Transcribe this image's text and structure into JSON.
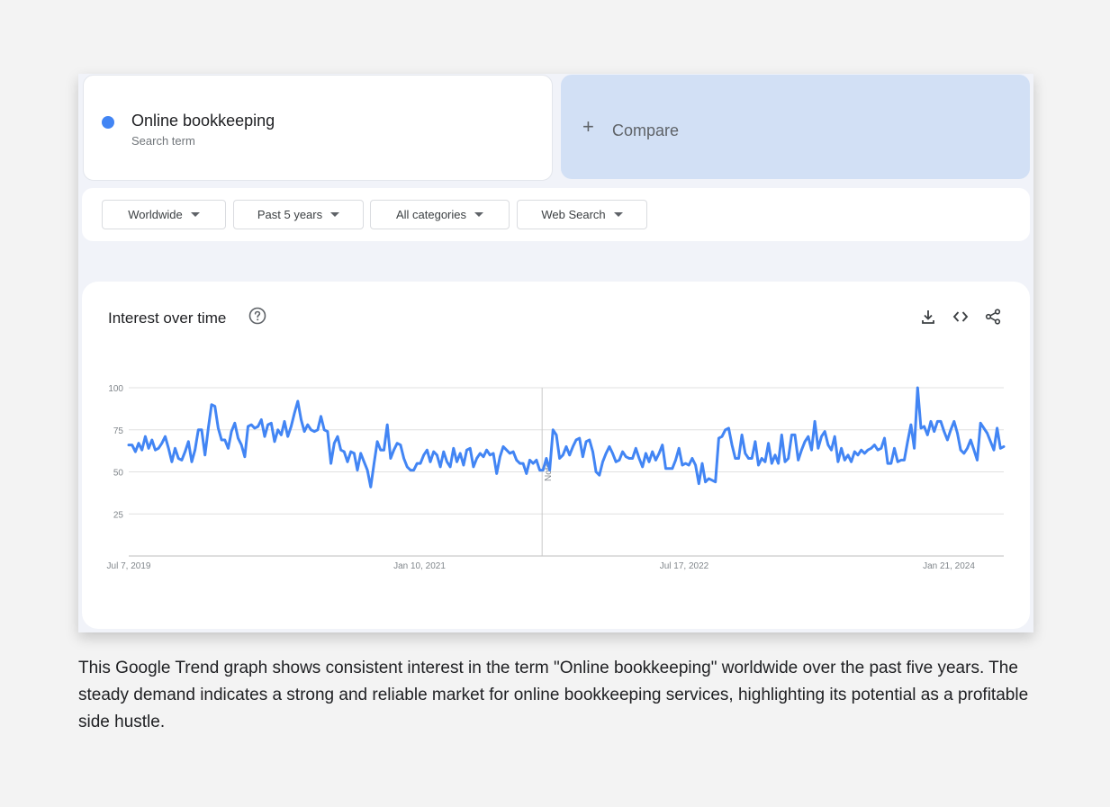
{
  "search_term": {
    "title": "Online bookkeeping",
    "subtitle": "Search term",
    "dot_color": "#4285f4"
  },
  "compare": {
    "plus": "+",
    "label": "Compare"
  },
  "filters": [
    {
      "label": "Worldwide"
    },
    {
      "label": "Past 5 years"
    },
    {
      "label": "All categories"
    },
    {
      "label": "Web Search"
    }
  ],
  "chart_card": {
    "title": "Interest over time",
    "help_icon": "help-circle-icon",
    "tools": [
      "download-icon",
      "embed-code-icon",
      "share-icon"
    ]
  },
  "chart_data": {
    "type": "line",
    "x_tick_labels": [
      "Jul 7, 2019",
      "Jan 10, 2021",
      "Jul 17, 2022",
      "Jan 21, 2024"
    ],
    "y_ticks": [
      100,
      75,
      50,
      25
    ],
    "ylim": [
      0,
      100
    ],
    "note_label": "Note",
    "grid": true,
    "series": [
      {
        "color": "#4285f4",
        "values": [
          66,
          66,
          62,
          67,
          63,
          71,
          64,
          69,
          63,
          64,
          67,
          71,
          64,
          56,
          64,
          58,
          57,
          62,
          68,
          56,
          63,
          75,
          75,
          60,
          76,
          90,
          89,
          76,
          69,
          69,
          64,
          74,
          79,
          70,
          66,
          59,
          77,
          78,
          76,
          77,
          81,
          71,
          78,
          79,
          68,
          75,
          72,
          80,
          71,
          77,
          85,
          92,
          81,
          74,
          78,
          75,
          74,
          75,
          83,
          75,
          74,
          55,
          67,
          71,
          63,
          62,
          56,
          62,
          61,
          51,
          61,
          56,
          51,
          41,
          55,
          68,
          63,
          63,
          78,
          58,
          63,
          67,
          66,
          58,
          53,
          51,
          51,
          55,
          55,
          60,
          63,
          56,
          62,
          60,
          53,
          62,
          56,
          53,
          64,
          56,
          61,
          54,
          63,
          64,
          53,
          58,
          61,
          59,
          63,
          60,
          61,
          49,
          59,
          65,
          63,
          61,
          62,
          57,
          55,
          55,
          49,
          57,
          55,
          57,
          51,
          51,
          58,
          51,
          75,
          72,
          58,
          60,
          65,
          60,
          65,
          69,
          70,
          59,
          68,
          69,
          62,
          50,
          48,
          56,
          61,
          65,
          61,
          56,
          57,
          62,
          59,
          58,
          58,
          64,
          58,
          53,
          61,
          56,
          62,
          57,
          61,
          66,
          52,
          52,
          52,
          57,
          64,
          54,
          55,
          54,
          58,
          54,
          43,
          55,
          44,
          46,
          45,
          44,
          70,
          71,
          75,
          76,
          66,
          58,
          58,
          72,
          61,
          58,
          58,
          68,
          54,
          58,
          56,
          67,
          55,
          60,
          55,
          72,
          56,
          58,
          72,
          72,
          57,
          63,
          68,
          71,
          63,
          80,
          64,
          71,
          74,
          66,
          63,
          71,
          56,
          64,
          57,
          60,
          56,
          62,
          60,
          63,
          61,
          63,
          64,
          66,
          63,
          64,
          70,
          55,
          55,
          64,
          56,
          57,
          57,
          68,
          78,
          64,
          100,
          76,
          77,
          72,
          80,
          74,
          80,
          80,
          74,
          69,
          75,
          80,
          73,
          63,
          61,
          64,
          69,
          63,
          57,
          79,
          76,
          73,
          68,
          63,
          76,
          64,
          65
        ]
      }
    ]
  },
  "caption": "This Google Trend graph shows consistent interest in the term \"Online bookkeeping\" worldwide over the past five years. The steady demand indicates a strong and reliable market for online bookkeeping services, highlighting its potential as a profitable side hustle."
}
